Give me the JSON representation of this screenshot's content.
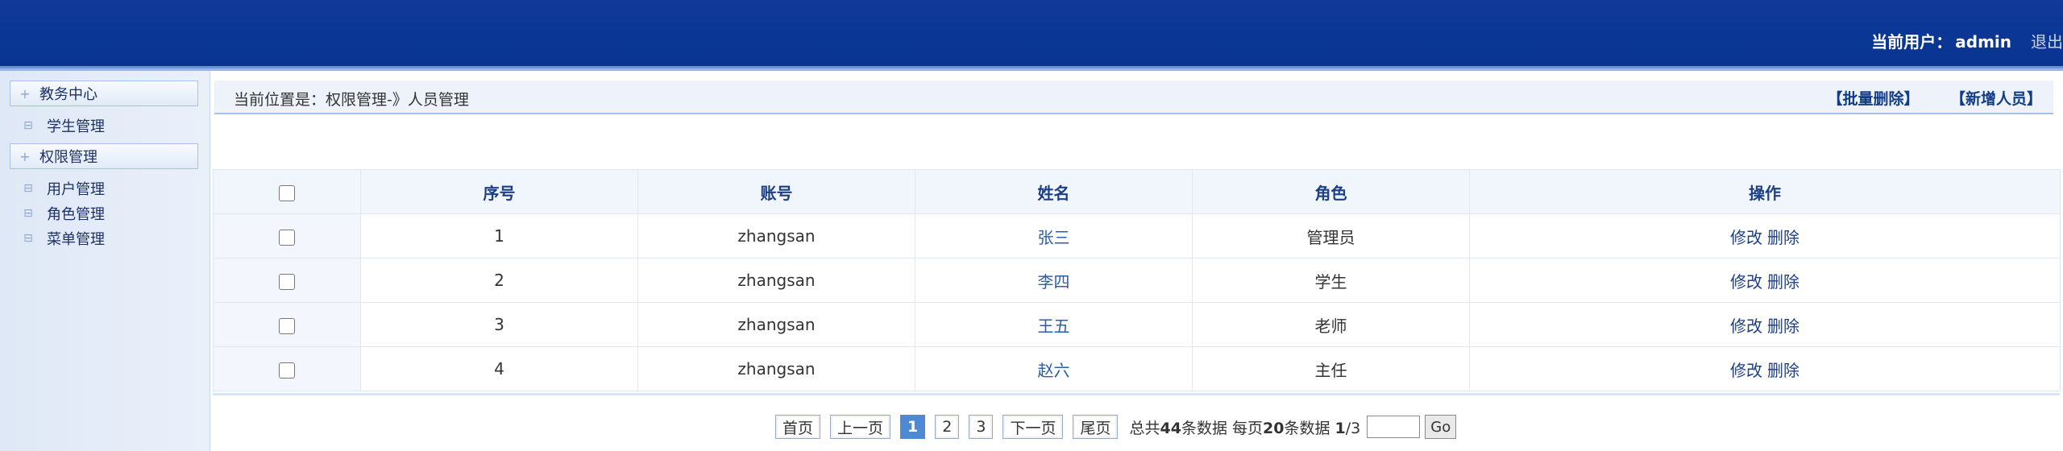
{
  "header": {
    "user_label": "当前用户：",
    "user_name": "admin",
    "logout": "退出"
  },
  "sidebar": {
    "groups": [
      {
        "label": "教务中心",
        "items": [
          "学生管理"
        ]
      },
      {
        "label": "权限管理",
        "items": [
          "用户管理",
          "角色管理",
          "菜单管理"
        ]
      }
    ]
  },
  "breadcrumb": "当前位置是：权限管理-》人员管理",
  "actions": {
    "batch_delete": "【批量删除】",
    "add_user": "【新增人员】"
  },
  "table": {
    "headers": [
      "序号",
      "账号",
      "姓名",
      "角色",
      "操作"
    ],
    "rows": [
      {
        "id": "1",
        "account": "zhangsan",
        "name": "张三",
        "role": "管理员"
      },
      {
        "id": "2",
        "account": "zhangsan",
        "name": "李四",
        "role": "学生"
      },
      {
        "id": "3",
        "account": "zhangsan",
        "name": "王五",
        "role": "老师"
      },
      {
        "id": "4",
        "account": "zhangsan",
        "name": "赵六",
        "role": "主任"
      }
    ],
    "edit_label": "修改",
    "delete_label": "删除"
  },
  "pager": {
    "first": "首页",
    "prev": "上一页",
    "pages": [
      "1",
      "2",
      "3"
    ],
    "current": "1",
    "next": "下一页",
    "last": "尾页",
    "total_prefix": "总共",
    "total_count": "44",
    "total_suffix": "条数据",
    "per_prefix": "每页",
    "per_count": "20",
    "per_suffix": "条数据",
    "page_status": "1",
    "page_total": "/3",
    "go": "Go"
  }
}
